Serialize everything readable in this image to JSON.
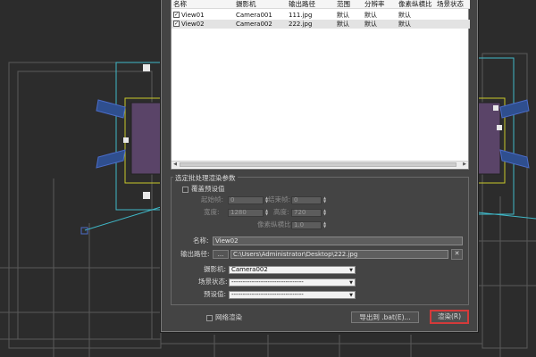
{
  "list": {
    "columns": [
      "名称",
      "摄影机",
      "输出路径",
      "范围",
      "分辨率",
      "像素纵横比",
      "场景状态"
    ],
    "rows": [
      {
        "name": "View01",
        "camera": "Camera001",
        "path": "111.jpg",
        "range": "默认",
        "resolution": "默认",
        "aspect": "默认",
        "checked": true
      },
      {
        "name": "View02",
        "camera": "Camera002",
        "path": "222.jpg",
        "range": "默认",
        "resolution": "默认",
        "aspect": "默认",
        "checked": true
      }
    ]
  },
  "params": {
    "group_title": "选定批处理渲染参数",
    "override_label": "覆盖预设值",
    "start_frame_label": "起始帧:",
    "start_frame_value": "0",
    "end_frame_label": "结束帧:",
    "end_frame_value": "0",
    "width_label": "宽度:",
    "width_value": "1280",
    "height_label": "高度:",
    "height_value": "720",
    "aspect_label": "像素纵横比:",
    "aspect_value": "1.0",
    "name_label": "名称:",
    "name_value": "View02",
    "output_label": "输出路径:",
    "browse_label": "...",
    "output_value": "C:\\Users\\Administrator\\Desktop\\222.jpg",
    "clear_label": "✕",
    "camera_label": "摄影机:",
    "camera_value": "Camera002",
    "scene_state_label": "场景状态:",
    "scene_state_value": "--------------------------------",
    "preset_label": "预设值:",
    "preset_value": "--------------------------------"
  },
  "footer": {
    "net_render_label": "网络渲染",
    "export_label": "导出到 .bat(E)...",
    "render_label": "渲染(R)"
  },
  "colors": {
    "dialog_bg": "#444444",
    "render_highlight": "#d43a3a"
  }
}
